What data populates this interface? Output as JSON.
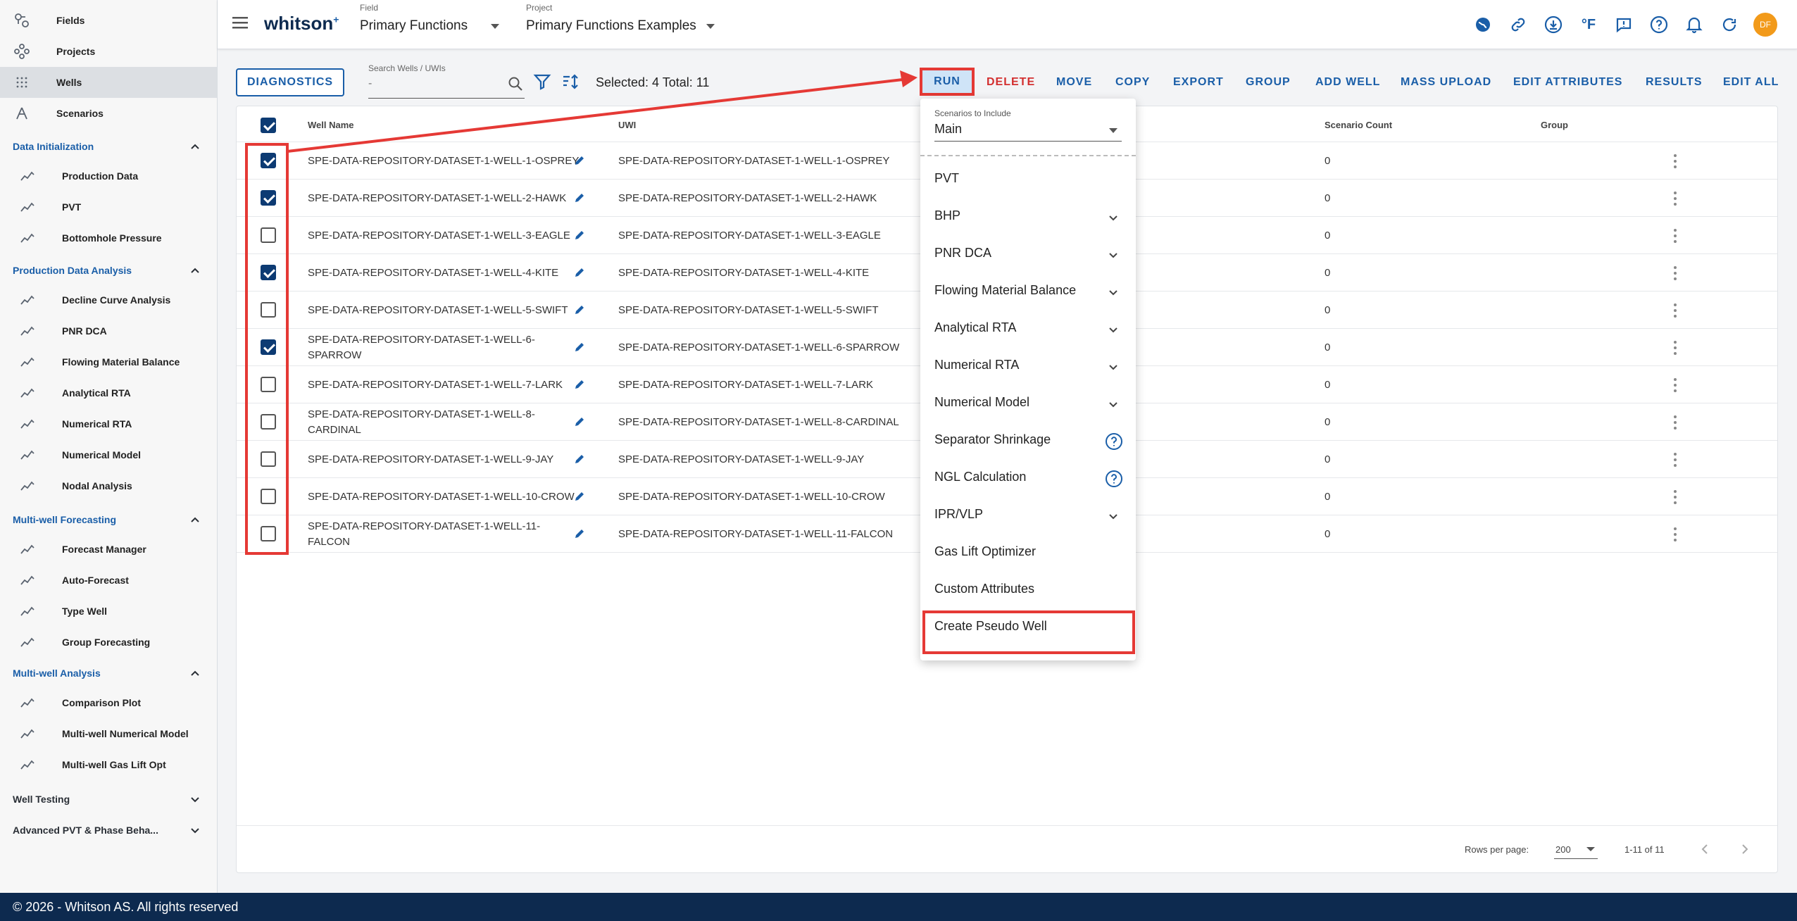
{
  "sidebar": {
    "top_items": [
      {
        "label": "Fields",
        "icon": "fields-icon"
      },
      {
        "label": "Projects",
        "icon": "projects-icon"
      },
      {
        "label": "Wells",
        "icon": "wells-icon"
      },
      {
        "label": "Scenarios",
        "icon": "scenarios-icon"
      }
    ],
    "sections": [
      {
        "label": "Data Initialization",
        "items": [
          "Production Data",
          "PVT",
          "Bottomhole Pressure"
        ]
      },
      {
        "label": "Production Data Analysis",
        "items": [
          "Decline Curve Analysis",
          "PNR DCA",
          "Flowing Material Balance",
          "Analytical RTA",
          "Numerical RTA",
          "Numerical Model",
          "Nodal Analysis"
        ]
      },
      {
        "label": "Multi-well Forecasting",
        "items": [
          "Forecast Manager",
          "Auto-Forecast",
          "Type Well",
          "Group Forecasting"
        ]
      },
      {
        "label": "Multi-well Analysis",
        "items": [
          "Comparison Plot",
          "Multi-well Numerical Model",
          "Multi-well Gas Lift Opt"
        ]
      }
    ],
    "collapsed_sections": [
      "Well Testing",
      "Advanced PVT & Phase Beha..."
    ]
  },
  "topbar": {
    "brand": "whitson",
    "brand_sup": "+",
    "field_label": "Field",
    "field_value": "Primary Functions",
    "project_label": "Project",
    "project_value": "Primary Functions Examples",
    "temp_unit": "°F",
    "avatar_initials": "DF"
  },
  "toolbar": {
    "diagnostics": "DIAGNOSTICS",
    "search_label": "Search Wells / UWIs",
    "search_placeholder": "-",
    "selection_info": "Selected: 4 Total: 11",
    "actions": [
      "RUN",
      "DELETE",
      "MOVE",
      "COPY",
      "EXPORT",
      "GROUP",
      "ADD WELL",
      "MASS UPLOAD",
      "EDIT ATTRIBUTES",
      "RESULTS",
      "EDIT ALL"
    ]
  },
  "table": {
    "headers": {
      "well_name": "Well Name",
      "uwi": "UWI",
      "scenario_count": "Scenario Count",
      "group": "Group"
    },
    "rows": [
      {
        "name": "SPE-DATA-REPOSITORY-DATASET-1-WELL-1-OSPREY",
        "uwi": "SPE-DATA-REPOSITORY-DATASET-1-WELL-1-OSPREY",
        "count": "0",
        "checked": true
      },
      {
        "name": "SPE-DATA-REPOSITORY-DATASET-1-WELL-2-HAWK",
        "uwi": "SPE-DATA-REPOSITORY-DATASET-1-WELL-2-HAWK",
        "count": "0",
        "checked": true
      },
      {
        "name": "SPE-DATA-REPOSITORY-DATASET-1-WELL-3-EAGLE",
        "uwi": "SPE-DATA-REPOSITORY-DATASET-1-WELL-3-EAGLE",
        "count": "0",
        "checked": false
      },
      {
        "name": "SPE-DATA-REPOSITORY-DATASET-1-WELL-4-KITE",
        "uwi": "SPE-DATA-REPOSITORY-DATASET-1-WELL-4-KITE",
        "count": "0",
        "checked": true
      },
      {
        "name": "SPE-DATA-REPOSITORY-DATASET-1-WELL-5-SWIFT",
        "uwi": "SPE-DATA-REPOSITORY-DATASET-1-WELL-5-SWIFT",
        "count": "0",
        "checked": false
      },
      {
        "name": "SPE-DATA-REPOSITORY-DATASET-1-WELL-6-SPARROW",
        "name_lines": [
          "SPE-DATA-REPOSITORY-DATASET-1-WELL-6-",
          "SPARROW"
        ],
        "uwi": "SPE-DATA-REPOSITORY-DATASET-1-WELL-6-SPARROW",
        "count": "0",
        "checked": true
      },
      {
        "name": "SPE-DATA-REPOSITORY-DATASET-1-WELL-7-LARK",
        "uwi": "SPE-DATA-REPOSITORY-DATASET-1-WELL-7-LARK",
        "count": "0",
        "checked": false
      },
      {
        "name": "SPE-DATA-REPOSITORY-DATASET-1-WELL-8-CARDINAL",
        "name_lines": [
          "SPE-DATA-REPOSITORY-DATASET-1-WELL-8-",
          "CARDINAL"
        ],
        "uwi": "SPE-DATA-REPOSITORY-DATASET-1-WELL-8-CARDINAL",
        "count": "0",
        "checked": false
      },
      {
        "name": "SPE-DATA-REPOSITORY-DATASET-1-WELL-9-JAY",
        "uwi": "SPE-DATA-REPOSITORY-DATASET-1-WELL-9-JAY",
        "count": "0",
        "checked": false
      },
      {
        "name": "SPE-DATA-REPOSITORY-DATASET-1-WELL-10-CROW",
        "uwi": "SPE-DATA-REPOSITORY-DATASET-1-WELL-10-CROW",
        "count": "0",
        "checked": false
      },
      {
        "name": "SPE-DATA-REPOSITORY-DATASET-1-WELL-11-FALCON",
        "name_lines": [
          "SPE-DATA-REPOSITORY-DATASET-1-WELL-11-",
          "FALCON"
        ],
        "uwi": "SPE-DATA-REPOSITORY-DATASET-1-WELL-11-FALCON",
        "count": "0",
        "checked": false
      }
    ],
    "rows_per_page_label": "Rows per page:",
    "rows_per_page": "200",
    "range": "1-11 of 11"
  },
  "run_menu": {
    "scenarios_label": "Scenarios to Include",
    "scenarios_value": "Main",
    "items": [
      {
        "label": "PVT",
        "suffix": "none"
      },
      {
        "label": "BHP",
        "suffix": "chevron"
      },
      {
        "label": "PNR DCA",
        "suffix": "chevron"
      },
      {
        "label": "Flowing Material Balance",
        "suffix": "chevron"
      },
      {
        "label": "Analytical RTA",
        "suffix": "chevron"
      },
      {
        "label": "Numerical RTA",
        "suffix": "chevron"
      },
      {
        "label": "Numerical Model",
        "suffix": "chevron"
      },
      {
        "label": "Separator Shrinkage",
        "suffix": "help"
      },
      {
        "label": "NGL Calculation",
        "suffix": "help"
      },
      {
        "label": "IPR/VLP",
        "suffix": "chevron"
      },
      {
        "label": "Gas Lift Optimizer",
        "suffix": "none"
      },
      {
        "label": "Custom Attributes",
        "suffix": "none"
      },
      {
        "label": "Create Pseudo Well",
        "suffix": "none"
      }
    ]
  },
  "footer": {
    "text": "© 2026 - Whitson AS. All rights reserved"
  },
  "colors": {
    "accent": "#1a5ea8",
    "annotation": "#e53935",
    "footer_bg": "#0d2a4f",
    "checkbox_checked": "#0d3b73"
  }
}
